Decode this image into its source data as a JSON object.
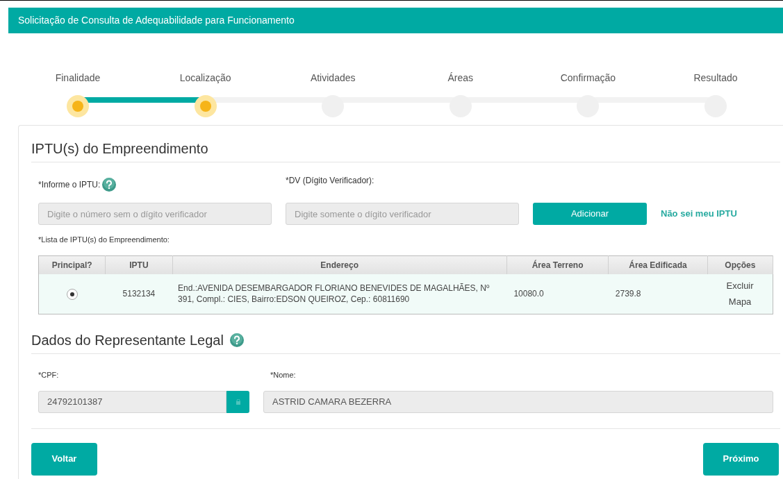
{
  "header": {
    "title": "Solicitação de Consulta de Adequabilidade para Funcionamento"
  },
  "steps": [
    {
      "label": "Finalidade",
      "completed": true
    },
    {
      "label": "Localização",
      "completed": true
    },
    {
      "label": "Atividades",
      "completed": false
    },
    {
      "label": "Áreas",
      "completed": false
    },
    {
      "label": "Confirmação",
      "completed": false
    },
    {
      "label": "Resultado",
      "completed": false
    }
  ],
  "iptu_section": {
    "title": "IPTU(s) do Empreendimento",
    "iptu_label": "*Informe o IPTU:",
    "iptu_placeholder": "Digite o número sem o dígito verificador",
    "dv_label": "*DV (Dígito Verificador):",
    "dv_placeholder": "Digite somente o dígito verificador",
    "add_button": "Adicionar",
    "help_link": "Não sei meu IPTU",
    "list_label": "*Lista de IPTU(s) do Empreendimento:",
    "table": {
      "columns": [
        "Principal?",
        "IPTU",
        "Endereço",
        "Área Terreno",
        "Área Edificada",
        "Opções"
      ],
      "rows": [
        {
          "selected": true,
          "iptu": "5132134",
          "address": "End.:AVENIDA DESEMBARGADOR FLORIANO BENEVIDES DE MAGALHÃES, Nº 391, Compl.: CIES, Bairro:EDSON QUEIROZ, Cep.: 60811690",
          "area_terreno": "10080.0",
          "area_edificada": "2739.8",
          "options": [
            "Excluir",
            "Mapa"
          ]
        }
      ]
    }
  },
  "representative": {
    "title": "Dados do Representante Legal",
    "cpf_label": "*CPF:",
    "cpf_value": "24792101387",
    "name_label": "*Nome:",
    "name_value": "ASTRID CAMARA BEZERRA"
  },
  "buttons": {
    "back": "Voltar",
    "next": "Próximo"
  }
}
